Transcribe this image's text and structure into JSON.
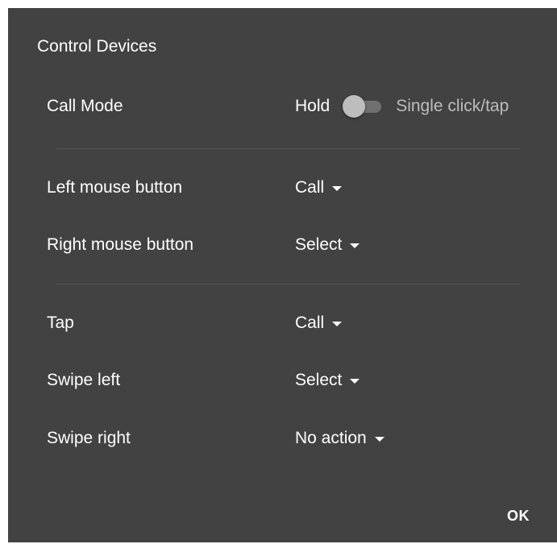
{
  "dialog": {
    "title": "Control Devices",
    "ok_label": "OK"
  },
  "call_mode": {
    "label": "Call Mode",
    "option_left": "Hold",
    "option_right": "Single click/tap",
    "selected": "Hold"
  },
  "mouse": {
    "left_label": "Left mouse button",
    "left_value": "Call",
    "right_label": "Right mouse button",
    "right_value": "Select"
  },
  "touch": {
    "tap_label": "Tap",
    "tap_value": "Call",
    "swipe_left_label": "Swipe left",
    "swipe_left_value": "Select",
    "swipe_right_label": "Swipe right",
    "swipe_right_value": "No action"
  },
  "colors": {
    "dialog_bg": "#424242",
    "text": "#ffffff",
    "muted_text": "#bdbdbd"
  },
  "icons": {
    "dropdown": "caret-down-icon"
  }
}
